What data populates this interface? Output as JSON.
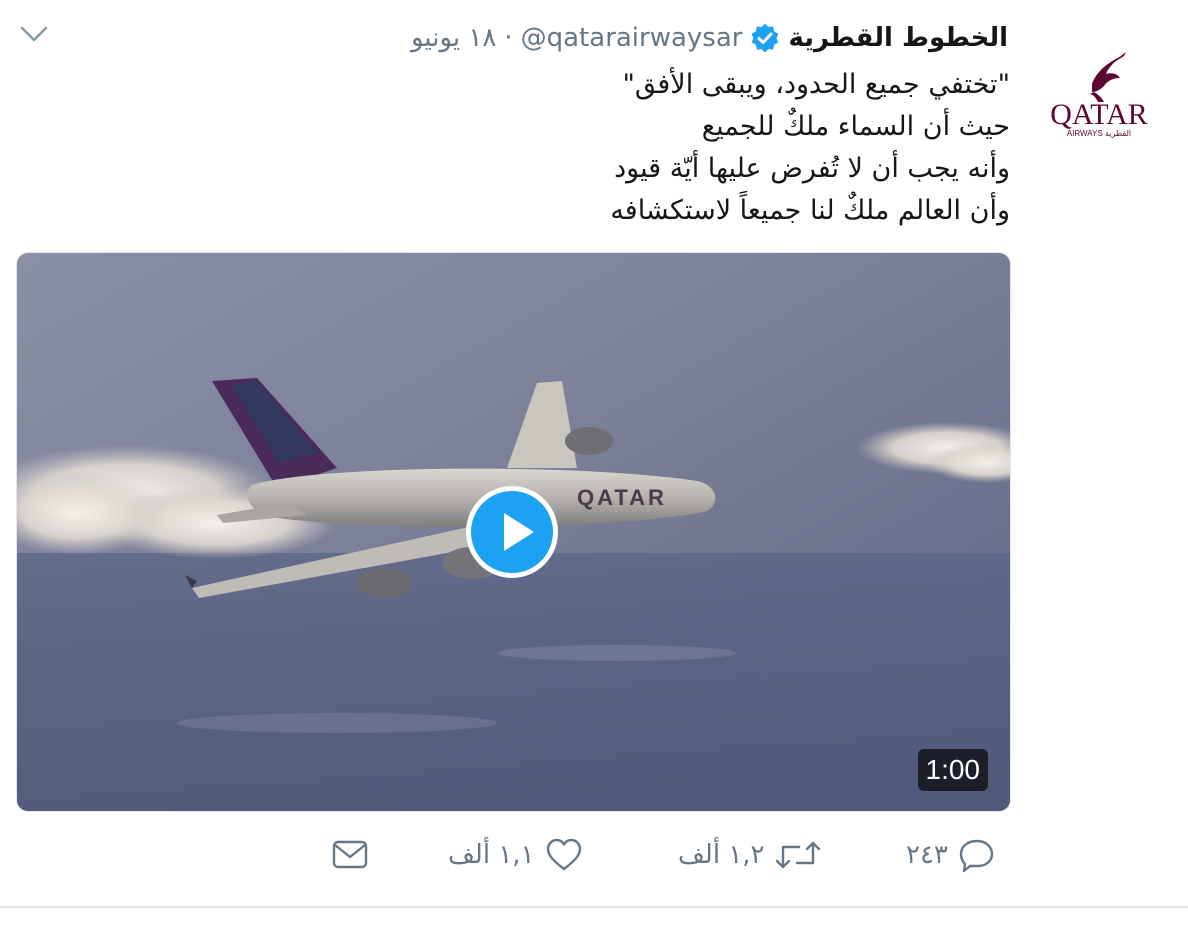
{
  "account": {
    "display_name": "الخطوط القطرية",
    "handle": "@qatarairwaysar",
    "separator": "·",
    "date": "١٨ يونيو",
    "avatar_logo_text": "QATAR",
    "avatar_logo_subtext": "AIRWAYS القطرية",
    "verified_color": "#1da1f2"
  },
  "tweet": {
    "lines": [
      "\"تختفي جميع الحدود، ويبقى الأفق\"",
      "حيث أن السماء ملكٌ للجميع",
      "وأنه يجب أن لا تُفرض عليها أيّة قيود",
      "وأن العالم ملكٌ لنا جميعاً لاستكشافه"
    ]
  },
  "media": {
    "type": "video",
    "duration": "1:00",
    "aircraft_livery_text": "QATAR",
    "play_button_color": "#1da1f2"
  },
  "actions": {
    "reply_count": "٢٤٣",
    "retweet_count": "١,٢ ألف",
    "like_count": "١,١ ألف",
    "reply_icon": "reply-icon",
    "retweet_icon": "retweet-icon",
    "like_icon": "heart-icon",
    "dm_icon": "envelope-icon"
  },
  "colors": {
    "text": "#14171a",
    "muted": "#657786",
    "accent": "#1da1f2",
    "brand": "#5c0632"
  }
}
